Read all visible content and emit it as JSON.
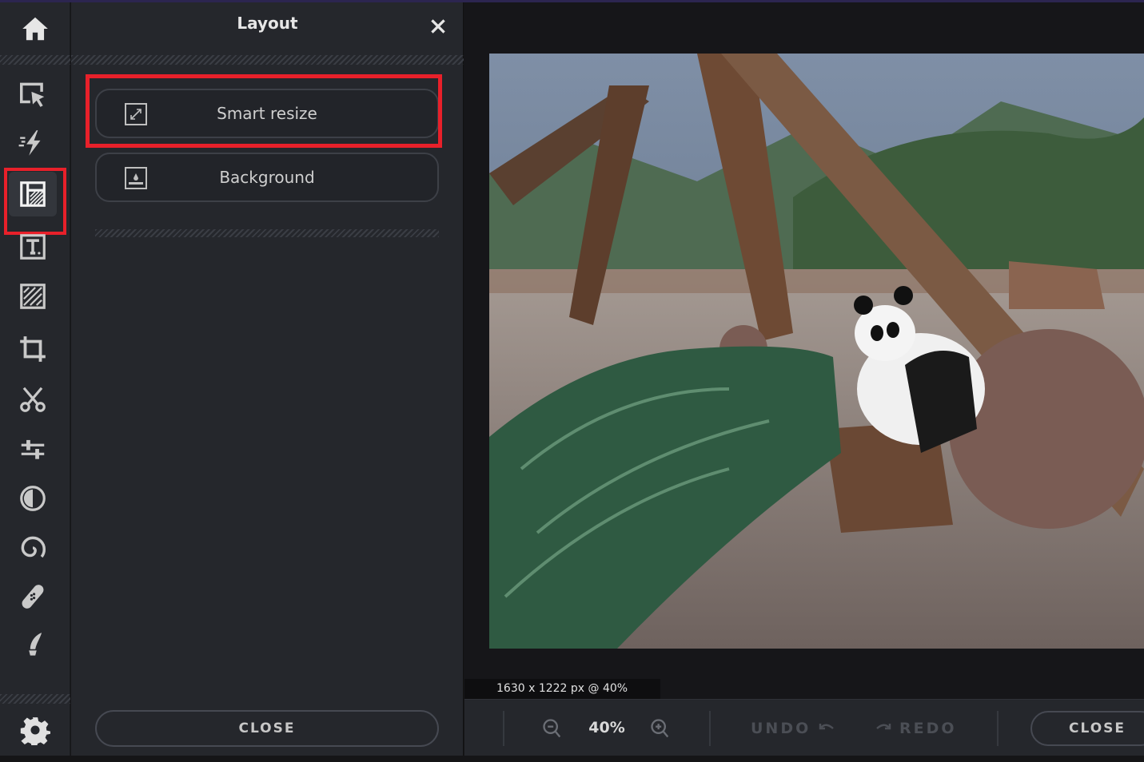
{
  "rail": {
    "home_icon": "home-icon",
    "tools": [
      {
        "name": "select",
        "icon": "select-cursor-icon",
        "active": false
      },
      {
        "name": "quick-actions",
        "icon": "lightning-icon",
        "active": false
      },
      {
        "name": "layout",
        "icon": "layout-icon",
        "active": true
      },
      {
        "name": "text",
        "icon": "text-icon",
        "active": false
      },
      {
        "name": "texture",
        "icon": "hatch-icon",
        "active": false
      },
      {
        "name": "crop",
        "icon": "crop-icon",
        "active": false
      },
      {
        "name": "cutout",
        "icon": "scissors-icon",
        "active": false
      },
      {
        "name": "adjust",
        "icon": "sliders-icon",
        "active": false
      },
      {
        "name": "filters",
        "icon": "contrast-icon",
        "active": false
      },
      {
        "name": "effects",
        "icon": "spiral-icon",
        "active": false
      },
      {
        "name": "retouch",
        "icon": "bandage-icon",
        "active": false
      },
      {
        "name": "draw",
        "icon": "brush-icon",
        "active": false
      }
    ],
    "settings_icon": "gear-icon"
  },
  "panel": {
    "title": "Layout",
    "options": [
      {
        "label": "Smart resize",
        "icon": "resize-icon",
        "highlighted": true
      },
      {
        "label": "Background",
        "icon": "background-icon",
        "highlighted": false
      }
    ],
    "close_label": "CLOSE"
  },
  "canvas": {
    "image_description": "Panda sitting beside wooden logs, bamboo branches and a large ball",
    "dimensions_label": "1630 x 1222 px @ 40%"
  },
  "bottombar": {
    "zoom_value": "40%",
    "undo_label": "UNDO",
    "redo_label": "REDO",
    "close_label": "CLOSE"
  },
  "colors": {
    "highlight": "#e8202a",
    "panel_bg": "#25272c",
    "canvas_bg": "#161619"
  }
}
